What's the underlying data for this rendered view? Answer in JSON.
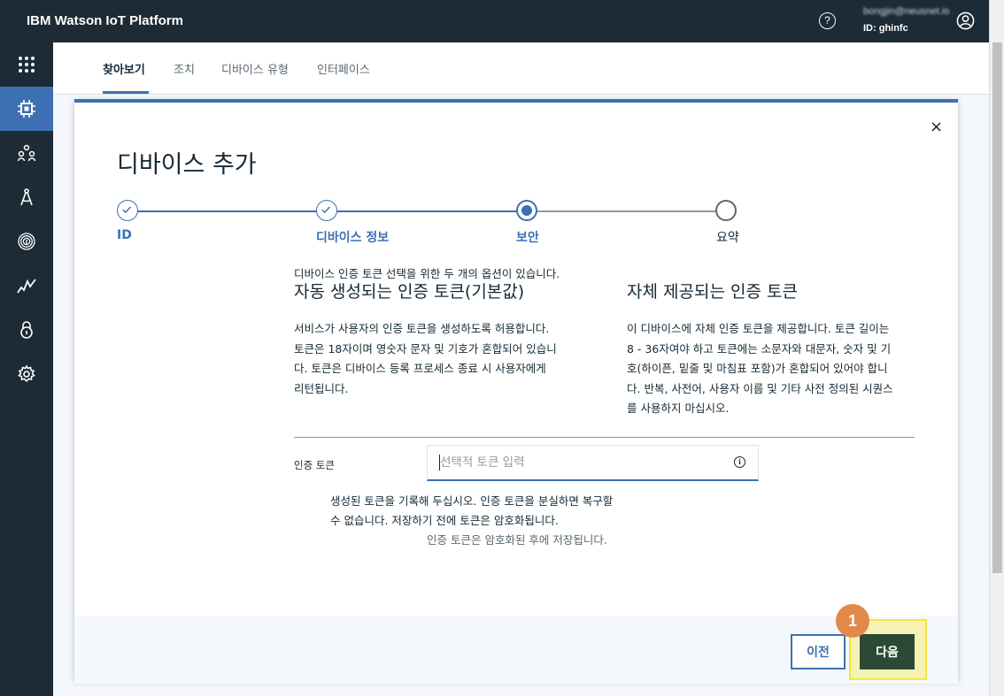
{
  "app": {
    "title": "IBM Watson IoT Platform",
    "help_glyph": "?",
    "user_email": "bongjin@neusnet.io",
    "user_id": "ID: ghinfc"
  },
  "sidebar": {
    "items": [
      {
        "icon": "app-grid-icon",
        "active": false
      },
      {
        "icon": "chip-icon",
        "active": true
      },
      {
        "icon": "members-icon",
        "active": false
      },
      {
        "icon": "compass-icon",
        "active": false
      },
      {
        "icon": "fingerprint-icon",
        "active": false
      },
      {
        "icon": "usage-chart-icon",
        "active": false
      },
      {
        "icon": "lock-icon",
        "active": false
      },
      {
        "icon": "settings-gear-icon",
        "active": false
      }
    ]
  },
  "tabs": [
    {
      "label": "찾아보기",
      "active": true
    },
    {
      "label": "조치",
      "active": false
    },
    {
      "label": "디바이스 유형",
      "active": false
    },
    {
      "label": "인터페이스",
      "active": false
    }
  ],
  "modal": {
    "title": "디바이스 추가",
    "close_glyph": "×",
    "steps": [
      {
        "label": "ID",
        "state": "complete"
      },
      {
        "label": "디바이스 정보",
        "state": "complete"
      },
      {
        "label": "보안",
        "state": "current"
      },
      {
        "label": "요약",
        "state": "incomplete"
      }
    ],
    "intro": "디바이스 인증 토큰 선택을 위한 두 개의 옵션이 있습니다.",
    "options": [
      {
        "title": "자동 생성되는 인증 토큰(기본값)",
        "lines": [
          "서비스가 사용자의 인증 토큰을 생성하도록 허용합니다.",
          "토큰은 18자이며 영숫자 문자 및 기호가 혼합되어 있습니",
          "다. 토큰은 디바이스 등록 프로세스 종료 시 사용자에게",
          "리턴됩니다."
        ]
      },
      {
        "title": "자체 제공되는 인증 토큰",
        "lines": [
          "이 디바이스에 자체 인증 토큰을 제공합니다. 토큰 길이는",
          "8 - 36자여야 하고 토큰에는 소문자와 대문자, 숫자 및 기",
          "호(하이픈, 밑줄 및 마침표 포함)가 혼합되어 있어야 합니",
          "다. 반복, 사전어, 사용자 이름 및 기타 사전 정의된 시퀀스",
          "를 사용하지 마십시오."
        ]
      }
    ],
    "token_field": {
      "label": "인증 토큰",
      "placeholder": "선택적 토큰 입력",
      "value": "",
      "info_glyph": "i"
    },
    "warning_lines": [
      "생성된 토큰을 기록해 두십시오. 인증 토큰을 분실하면 복구할",
      "수 없습니다. 저장하기 전에 토큰은 암호화됩니다."
    ],
    "encrypted_note": "인증 토큰은 암호화된 후에 저장됩니다.",
    "buttons": {
      "prev": "이전",
      "next": "다음"
    },
    "callout_number": "1"
  },
  "colors": {
    "accent": "#3d70b2",
    "topbar": "#1c2b36",
    "next_button": "#2c4a33",
    "callout": "#e2894a",
    "highlight": "#f7e833"
  }
}
